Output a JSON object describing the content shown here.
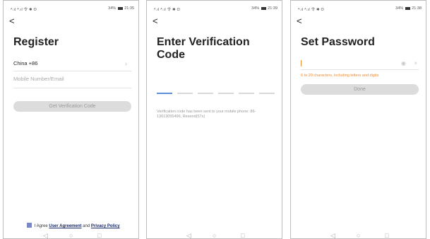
{
  "screens": [
    {
      "status": {
        "signal": "ᴬ.ıl ᴬ.ıl 令 ✱ ʘ",
        "battery": "34%",
        "time": "21:35"
      },
      "back": "<",
      "title": "Register",
      "country_value": "China +86",
      "chevron": "›",
      "mobile_placeholder": "Mobile Number/Email",
      "button": "Get Verification Code",
      "agreement": {
        "prefix": "I Agree",
        "link1": "User Agreement",
        "and": "and",
        "link2": "Privacy Policy"
      },
      "nav": {
        "back": "◁",
        "home": "○",
        "recent": "□"
      }
    },
    {
      "status": {
        "signal": "ᴬ.ıl ᴬ.ıl 令 ✱ ʘ",
        "battery": "34%",
        "time": "21:39"
      },
      "back": "<",
      "title": "Enter Verification Code",
      "info": "Verification code has been sent to your mobile phone: 86-13613055496, Resend(57s)",
      "nav": {
        "back": "◁",
        "home": "○",
        "recent": "□"
      }
    },
    {
      "status": {
        "signal": "ᴬ.ıl ᴬ.ıl 令 ✱ ʘ",
        "battery": "34%",
        "time": "21:38"
      },
      "back": "<",
      "title": "Set Password",
      "eye": "◉",
      "clear": "×",
      "hint": "6 to 20 characters, including letters and digits",
      "button": "Done",
      "nav": {
        "back": "◁",
        "home": "○",
        "recent": "□"
      }
    }
  ]
}
